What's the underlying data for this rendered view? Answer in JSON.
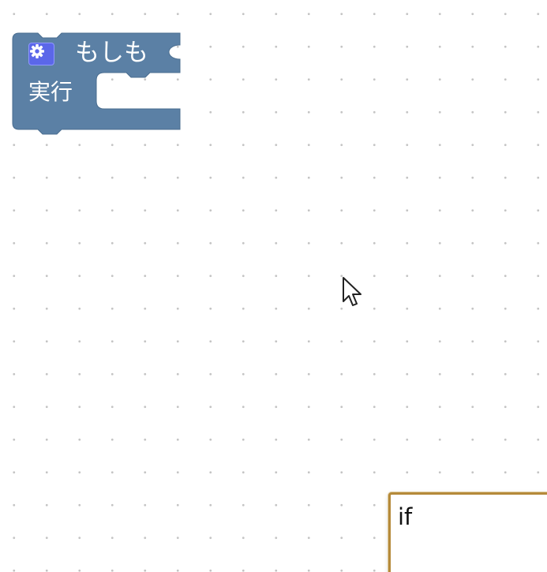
{
  "workspace": {
    "background": "#ffffff",
    "grid_dot_color": "#c4c4c4"
  },
  "block": {
    "type": "controls_if",
    "color": "#5b80a5",
    "if_label": "もしも",
    "do_label": "実行",
    "mutator_icon": "gear-icon"
  },
  "popup": {
    "text": "if",
    "border_color": "#b58a3a"
  },
  "pointer": {
    "icon": "mouse-pointer-icon"
  }
}
